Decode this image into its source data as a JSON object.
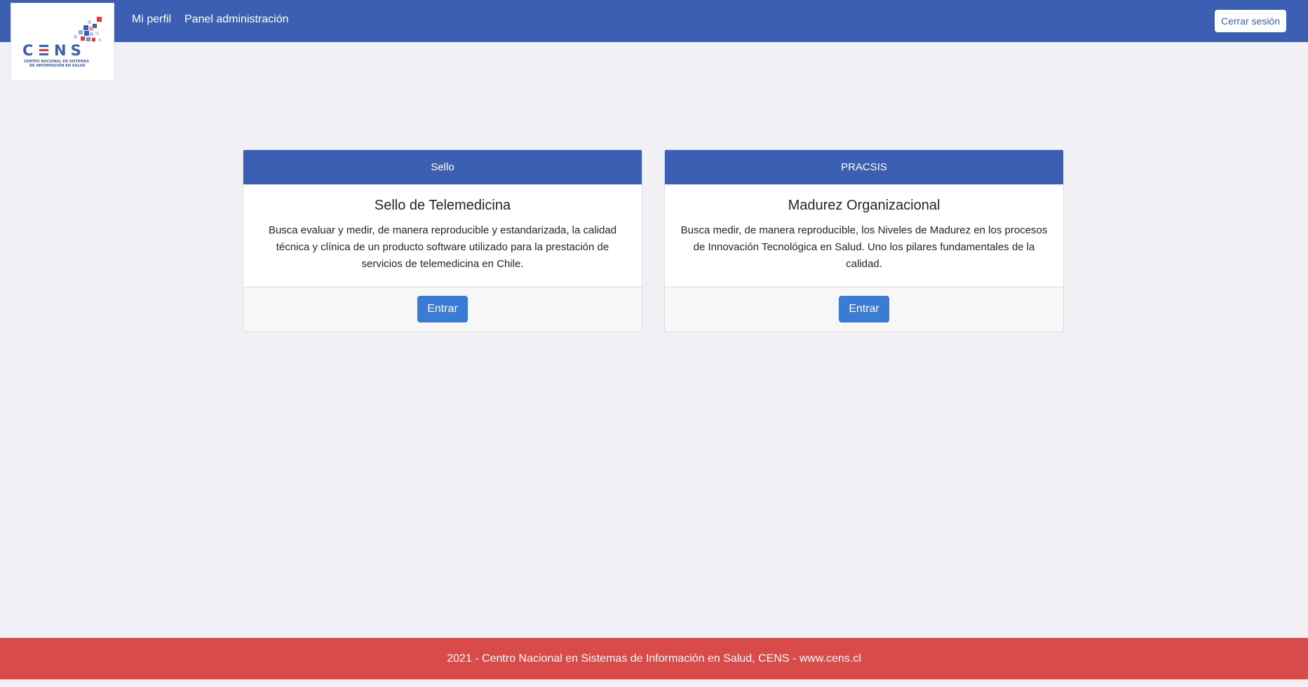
{
  "brand": {
    "logo_name": "CENS",
    "logo_subtitle_line1": "CENTRO NACIONAL EN SISTEMAS",
    "logo_subtitle_line2": "DE INFORMACIÓN EN SALUD",
    "colors": {
      "blue": "#3d5fb3",
      "red": "#e03c3c"
    }
  },
  "navbar": {
    "links": [
      {
        "label": "Mi perfil"
      },
      {
        "label": "Panel administración"
      }
    ],
    "logout_label": "Cerrar sesión",
    "background": "#3d5fb3"
  },
  "cards": [
    {
      "header": "Sello",
      "title": "Sello de Telemedicina",
      "text": "Busca evaluar y medir, de manera reproducible y estandarizada, la calidad técnica y clínica de un producto software utilizado para la prestación de servicios de telemedicina en Chile.",
      "button_label": "Entrar"
    },
    {
      "header": "PRACSIS",
      "title": "Madurez Organizacional",
      "text": "Busca medir, de manera reproducible, los Niveles de Madurez en los procesos de Innovación Tecnológica en Salud. Uno los pilares fundamentales de la calidad.",
      "button_label": "Entrar"
    }
  ],
  "footer": {
    "text": "2021 - Centro Nacional en Sistemas de Información en Salud, CENS - www.cens.cl",
    "background": "#d94a4a"
  }
}
